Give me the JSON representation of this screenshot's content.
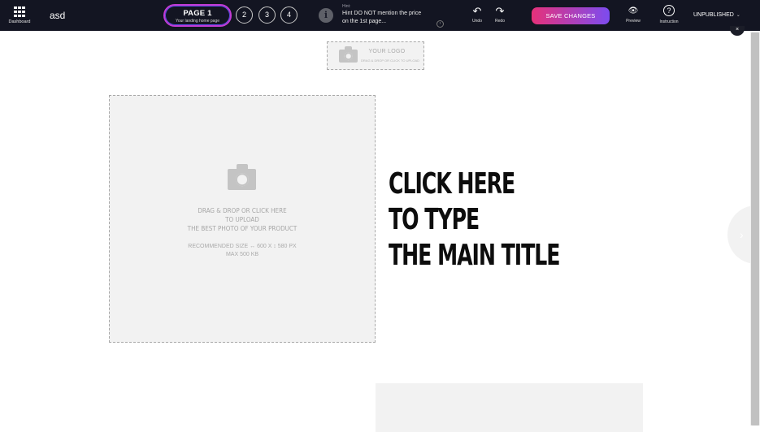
{
  "topbar": {
    "dashboard_label": "Dashboard",
    "site_name": "asd",
    "pages": {
      "active_title": "PAGE 1",
      "active_subtitle": "Your landing home page",
      "others": [
        "2",
        "3",
        "4"
      ]
    },
    "hint": {
      "icon_glyph": "i",
      "label": "Hint:",
      "text": "Hint DO NOT mention the price on the 1st page...",
      "more_glyph": "›"
    },
    "undo": {
      "glyph": "↶",
      "label": "Undo"
    },
    "redo": {
      "glyph": "↷",
      "label": "Redo"
    },
    "save_label": "SAVE CHANGES",
    "preview": {
      "glyph": "👁",
      "label": "Preview"
    },
    "instruction": {
      "glyph": "?",
      "label": "Instruction"
    },
    "status_label": "UNPUBLISHED",
    "status_chevron": "⌄",
    "close_glyph": "×"
  },
  "canvas": {
    "logo": {
      "title": "YOUR LOGO",
      "subtitle": "DRAG & DROP OR CLICK TO UPLOAD"
    },
    "photo": {
      "line1": "DRAG & DROP OR CLICK HERE",
      "line2": "TO UPLOAD",
      "line3": "THE BEST PHOTO OF YOUR PRODUCT",
      "size_note": "RECOMMENDED SIZE ↔ 600 X ↕ 580 PX",
      "max_note": "MAX 500 KB"
    },
    "title_lines": [
      "CLICK HERE",
      "TO TYPE",
      "THE MAIN TITLE"
    ],
    "next_glyph": "›"
  },
  "colors": {
    "topbar_bg": "#131522",
    "save_gradient_start": "#e6317a",
    "save_gradient_end": "#7c4cf0",
    "placeholder_bg": "#f2f2f2"
  }
}
